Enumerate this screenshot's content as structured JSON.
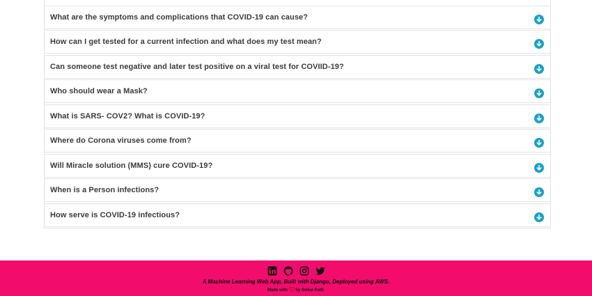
{
  "faq": {
    "items": [
      {
        "question": "What are the symptoms and complications that COVID-19 can cause?",
        "icon": "arrow-down-circle-icon"
      },
      {
        "question": "How can I get tested for a current infection and what does my test mean?",
        "icon": "arrow-down-circle-icon"
      },
      {
        "question": "Can someone test negative and later test positive on a viral test for COVIID-19?",
        "icon": "arrow-down-circle-icon"
      },
      {
        "question": "Who should wear a Mask?",
        "icon": "arrow-down-circle-icon"
      },
      {
        "question": "What is SARS- COV2? What is COVID-19?",
        "icon": "arrow-down-circle-icon"
      },
      {
        "question": "Where do Corona viruses come from?",
        "icon": "arrow-down-circle-icon"
      },
      {
        "question": "Will Miracle solution (MMS) cure COVID-19?",
        "icon": "arrow-down-circle-icon"
      },
      {
        "question": "When is a Person infections?",
        "icon": "arrow-down-circle-icon"
      },
      {
        "question": "How serve is COVID-19 infectious?",
        "icon": "arrow-down-circle-icon"
      }
    ],
    "accent_color": "#17a2c8"
  },
  "footer": {
    "background_color": "#f20d6d",
    "social_icons": [
      "linkedin-icon",
      "github-icon",
      "instagram-icon",
      "twitter-icon"
    ],
    "tagline": "A Machine Learning Web App, Built with Django, Deployed using AWS.",
    "made_with_prefix": "Made with",
    "made_with_suffix": "by Gokul Patil."
  }
}
